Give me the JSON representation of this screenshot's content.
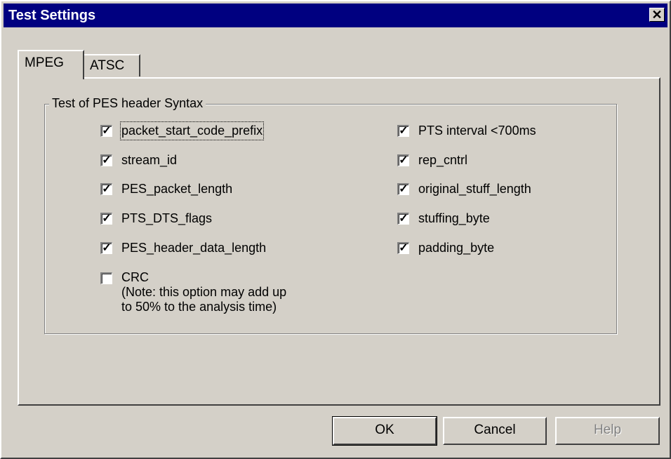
{
  "window": {
    "title": "Test Settings",
    "close_glyph": "✕"
  },
  "tabs": [
    {
      "label": "MPEG",
      "active": true
    },
    {
      "label": "ATSC",
      "active": false
    }
  ],
  "group": {
    "title": "Test of PES header Syntax"
  },
  "left_options": [
    {
      "label": "packet_start_code_prefix",
      "checked": true,
      "focused": true
    },
    {
      "label": "stream_id",
      "checked": true
    },
    {
      "label": "PES_packet_length",
      "checked": true
    },
    {
      "label": "PTS_DTS_flags",
      "checked": true
    },
    {
      "label": "PES_header_data_length",
      "checked": true
    },
    {
      "label": "CRC",
      "checked": false,
      "note1": "(Note: this option may add up",
      "note2": "to 50% to the analysis time)"
    }
  ],
  "right_options": [
    {
      "label": "PTS interval <700ms",
      "checked": true
    },
    {
      "label": "rep_cntrl",
      "checked": true
    },
    {
      "label": "original_stuff_length",
      "checked": true
    },
    {
      "label": "stuffing_byte",
      "checked": true
    },
    {
      "label": "padding_byte",
      "checked": true
    }
  ],
  "check_glyph": "✓",
  "buttons": {
    "ok": "OK",
    "cancel": "Cancel",
    "help": "Help"
  }
}
